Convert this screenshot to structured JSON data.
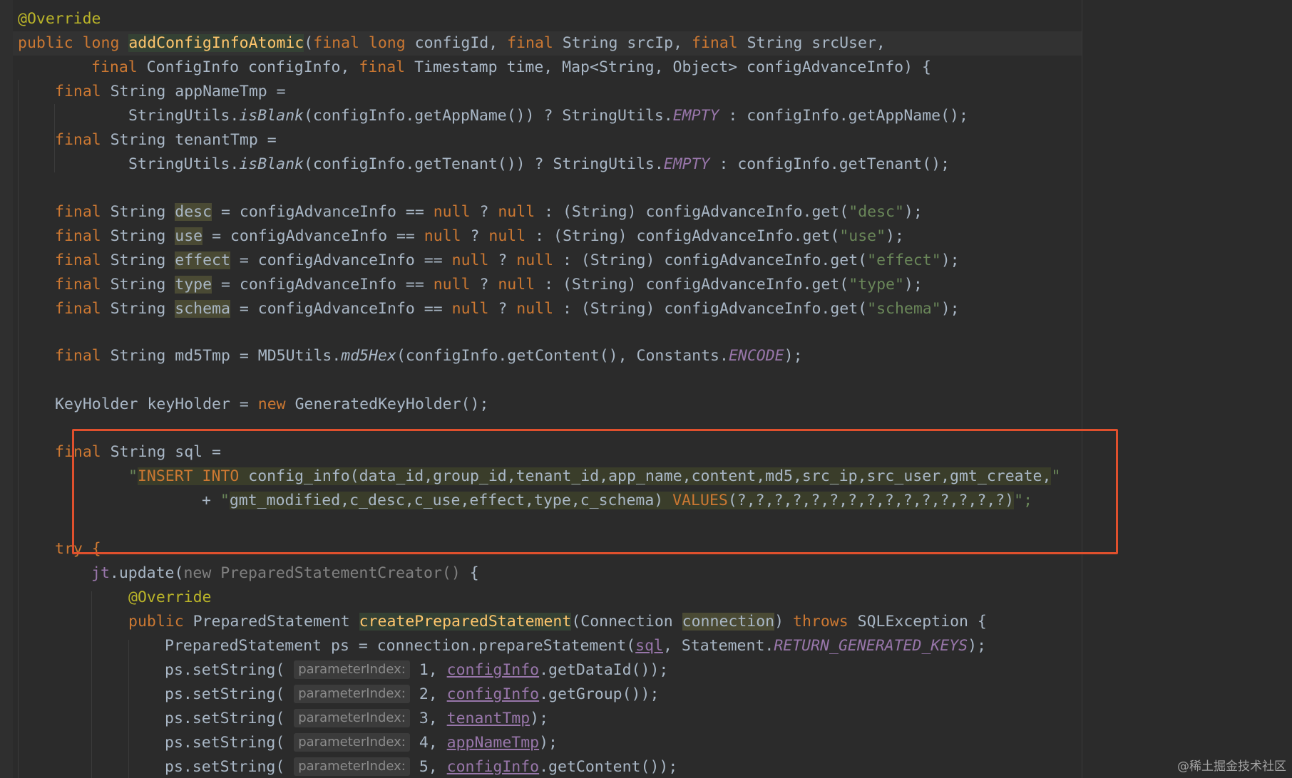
{
  "editor": {
    "language": "Java",
    "colors": {
      "background": "#2b2b2b",
      "keyword": "#cc7832",
      "string": "#6a8759",
      "annotation": "#bbb529",
      "method_declaration": "#ffc66d",
      "static_field": "#9876aa",
      "highlight_box": "#e0502d"
    },
    "code": {
      "l1_annotation": "@Override",
      "l2_public": "public ",
      "l2_long": "long ",
      "l2_method": "addConfigInfoAtomic",
      "l2_open": "(",
      "l2_final1": "final ",
      "l2_long2": "long ",
      "l2_p1": "configId, ",
      "l2_final2": "final ",
      "l2_p2": "String srcIp, ",
      "l2_final3": "final ",
      "l2_p3": "String srcUser,",
      "l3_final1": "final ",
      "l3_p1": "ConfigInfo configInfo, ",
      "l3_final2": "final ",
      "l3_p2": "Timestamp time, Map<String, Object> configAdvanceInfo) {",
      "l4_final": "final ",
      "l4_rest": "String appNameTmp =",
      "l5_a": "StringUtils.",
      "l5_isBlank": "isBlank",
      "l5_b": "(configInfo.getAppName()) ? StringUtils.",
      "l5_empty": "EMPTY",
      "l5_c": " : configInfo.getAppName();",
      "l6_final": "final ",
      "l6_rest": "String tenantTmp =",
      "l7_a": "StringUtils.",
      "l7_isBlank": "isBlank",
      "l7_b": "(configInfo.getTenant()) ? StringUtils.",
      "l7_empty": "EMPTY",
      "l7_c": " : configInfo.getTenant();",
      "adv_rows": [
        {
          "final": "final ",
          "type": "String ",
          "var": "desc",
          "a": " = configAdvanceInfo == ",
          "null1": "null",
          "q": " ? ",
          "null2": "null",
          "b": " : (String) configAdvanceInfo.get(",
          "key": "\"desc\"",
          "end": ");"
        },
        {
          "final": "final ",
          "type": "String ",
          "var": "use",
          "a": " = configAdvanceInfo == ",
          "null1": "null",
          "q": " ? ",
          "null2": "null",
          "b": " : (String) configAdvanceInfo.get(",
          "key": "\"use\"",
          "end": ");"
        },
        {
          "final": "final ",
          "type": "String ",
          "var": "effect",
          "a": " = configAdvanceInfo == ",
          "null1": "null",
          "q": " ? ",
          "null2": "null",
          "b": " : (String) configAdvanceInfo.get(",
          "key": "\"effect\"",
          "end": ");"
        },
        {
          "final": "final ",
          "type": "String ",
          "var": "type",
          "a": " = configAdvanceInfo == ",
          "null1": "null",
          "q": " ? ",
          "null2": "null",
          "b": " : (String) configAdvanceInfo.get(",
          "key": "\"type\"",
          "end": ");"
        },
        {
          "final": "final ",
          "type": "String ",
          "var": "schema",
          "a": " = configAdvanceInfo == ",
          "null1": "null",
          "q": " ? ",
          "null2": "null",
          "b": " : (String) configAdvanceInfo.get(",
          "key": "\"schema\"",
          "end": ");"
        }
      ],
      "md5_final": "final ",
      "md5_a": "String md5Tmp = MD5Utils.",
      "md5_fn": "md5Hex",
      "md5_b": "(configInfo.getContent(), Constants.",
      "md5_const": "ENCODE",
      "md5_end": ");",
      "kh_a": "KeyHolder keyHolder = ",
      "kh_new": "new",
      "kh_b": " GeneratedKeyHolder();",
      "sql_final": "final ",
      "sql_decl": "String sql =",
      "sql1_q": "\"",
      "sql1_insert": "INSERT INTO",
      "sql1_rest": " config_info(data_id,group_id,tenant_id,app_name,content,md5,src_ip,src_user,gmt_create,",
      "sql1_endq": "\"",
      "sql2_plus": "+ ",
      "sql2_q": "\"",
      "sql2_a": "gmt_modified,c_desc,c_use,effect,type,c_schema) ",
      "sql2_values": "VALUES",
      "sql2_b": "(?,?,?,?,?,?,?,?,?,?,?,?,?,?,?)",
      "sql2_end": "\";",
      "try": "try {",
      "jt_a": "jt",
      "jt_b": ".update(",
      "jt_new": "new PreparedStatementCreator()",
      "jt_end": " {",
      "inner_ann": "@Override",
      "cps_public": "public ",
      "cps_type": "PreparedStatement ",
      "cps_name": "createPreparedStatement",
      "cps_open": "(Connection ",
      "cps_param": "connection",
      "cps_close": ") ",
      "cps_throws": "throws",
      "cps_end": " SQLException {",
      "ps_a": "PreparedStatement ps = connection.prepareStatement(",
      "ps_sql": "sql",
      "ps_b": ", Statement.",
      "ps_const": "RETURN_GENERATED_KEYS",
      "ps_end": ");",
      "set_rows": [
        {
          "call": "ps.setString( ",
          "hint": "parameterIndex:",
          "idx": " 1, ",
          "arg": "configInfo",
          "rest": ".getDataId());"
        },
        {
          "call": "ps.setString( ",
          "hint": "parameterIndex:",
          "idx": " 2, ",
          "arg": "configInfo",
          "rest": ".getGroup());"
        },
        {
          "call": "ps.setString( ",
          "hint": "parameterIndex:",
          "idx": " 3, ",
          "arg": "tenantTmp",
          "rest": ");"
        },
        {
          "call": "ps.setString( ",
          "hint": "parameterIndex:",
          "idx": " 4, ",
          "arg": "appNameTmp",
          "rest": ");"
        },
        {
          "call": "ps.setString( ",
          "hint": "parameterIndex:",
          "idx": " 5, ",
          "arg": "configInfo",
          "rest": ".getContent());"
        }
      ]
    }
  },
  "watermark": "@稀土掘金技术社区"
}
